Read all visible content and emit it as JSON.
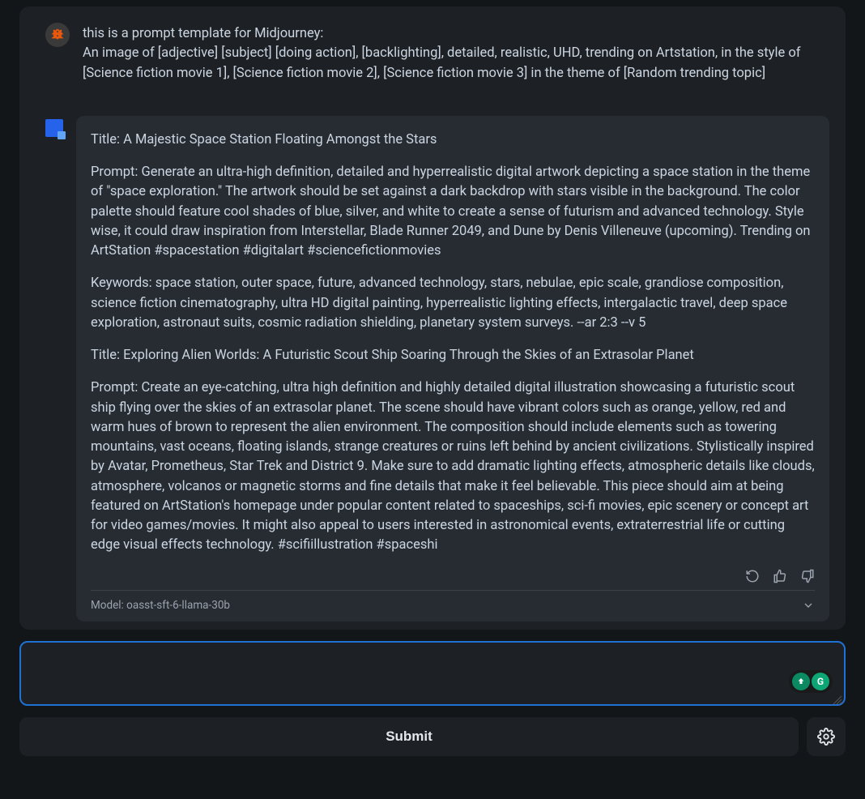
{
  "user_message": {
    "text": "this is a prompt template for Midjourney:\nAn image of [adjective] [subject] [doing action], [backlighting], detailed, realistic, UHD, trending on Artstation, in the style of [Science fiction movie 1], [Science fiction movie 2], [Science fiction movie 3] in the theme of [Random trending topic]"
  },
  "ai_response": {
    "paragraphs": [
      "Title: A Majestic Space Station Floating Amongst the Stars",
      "Prompt: Generate an ultra-high definition, detailed and hyperrealistic digital artwork depicting a space station in the theme of \"space exploration.\" The artwork should be set against a dark backdrop with stars visible in the background. The color palette should feature cool shades of blue, silver, and white to create a sense of futurism and advanced technology. Style wise, it could draw inspiration from Interstellar, Blade Runner 2049, and Dune by Denis Villeneuve (upcoming). Trending on ArtStation #spacestation #digitalart #sciencefictionmovies",
      "Keywords: space station, outer space, future, advanced technology, stars, nebulae, epic scale, grandiose composition, science fiction cinematography, ultra HD digital painting, hyperrealistic lighting effects, intergalactic travel, deep space exploration, astronaut suits, cosmic radiation shielding, planetary system surveys. --ar 2:3 --v 5",
      "Title: Exploring Alien Worlds: A Futuristic Scout Ship Soaring Through the Skies of an Extrasolar Planet",
      "Prompt: Create an eye-catching, ultra high definition and highly detailed digital illustration showcasing a futuristic scout ship flying over the skies of an extrasolar planet. The scene should have vibrant colors such as orange, yellow, red and warm hues of brown to represent the alien environment. The composition should include elements such as towering mountains, vast oceans, floating islands, strange creatures or ruins left behind by ancient civilizations. Stylistically inspired by Avatar, Prometheus, Star Trek and District 9. Make sure to add dramatic lighting effects, atmospheric details like clouds, atmosphere, volcanos or magnetic storms and fine details that make it feel believable. This piece should aim at being featured on ArtStation's homepage under popular content related to spaceships, sci-fi movies, epic scenery or concept art for video games/movies. It might also appeal to users interested in astronomical events, extraterrestrial life or cutting edge visual effects technology. #scifiillustration #spaceshi"
    ],
    "model_label": "Model: oasst-sft-6-llama-30b"
  },
  "input": {
    "value": "",
    "placeholder": ""
  },
  "submit_label": "Submit",
  "grammarly": {
    "g_label": "G"
  }
}
